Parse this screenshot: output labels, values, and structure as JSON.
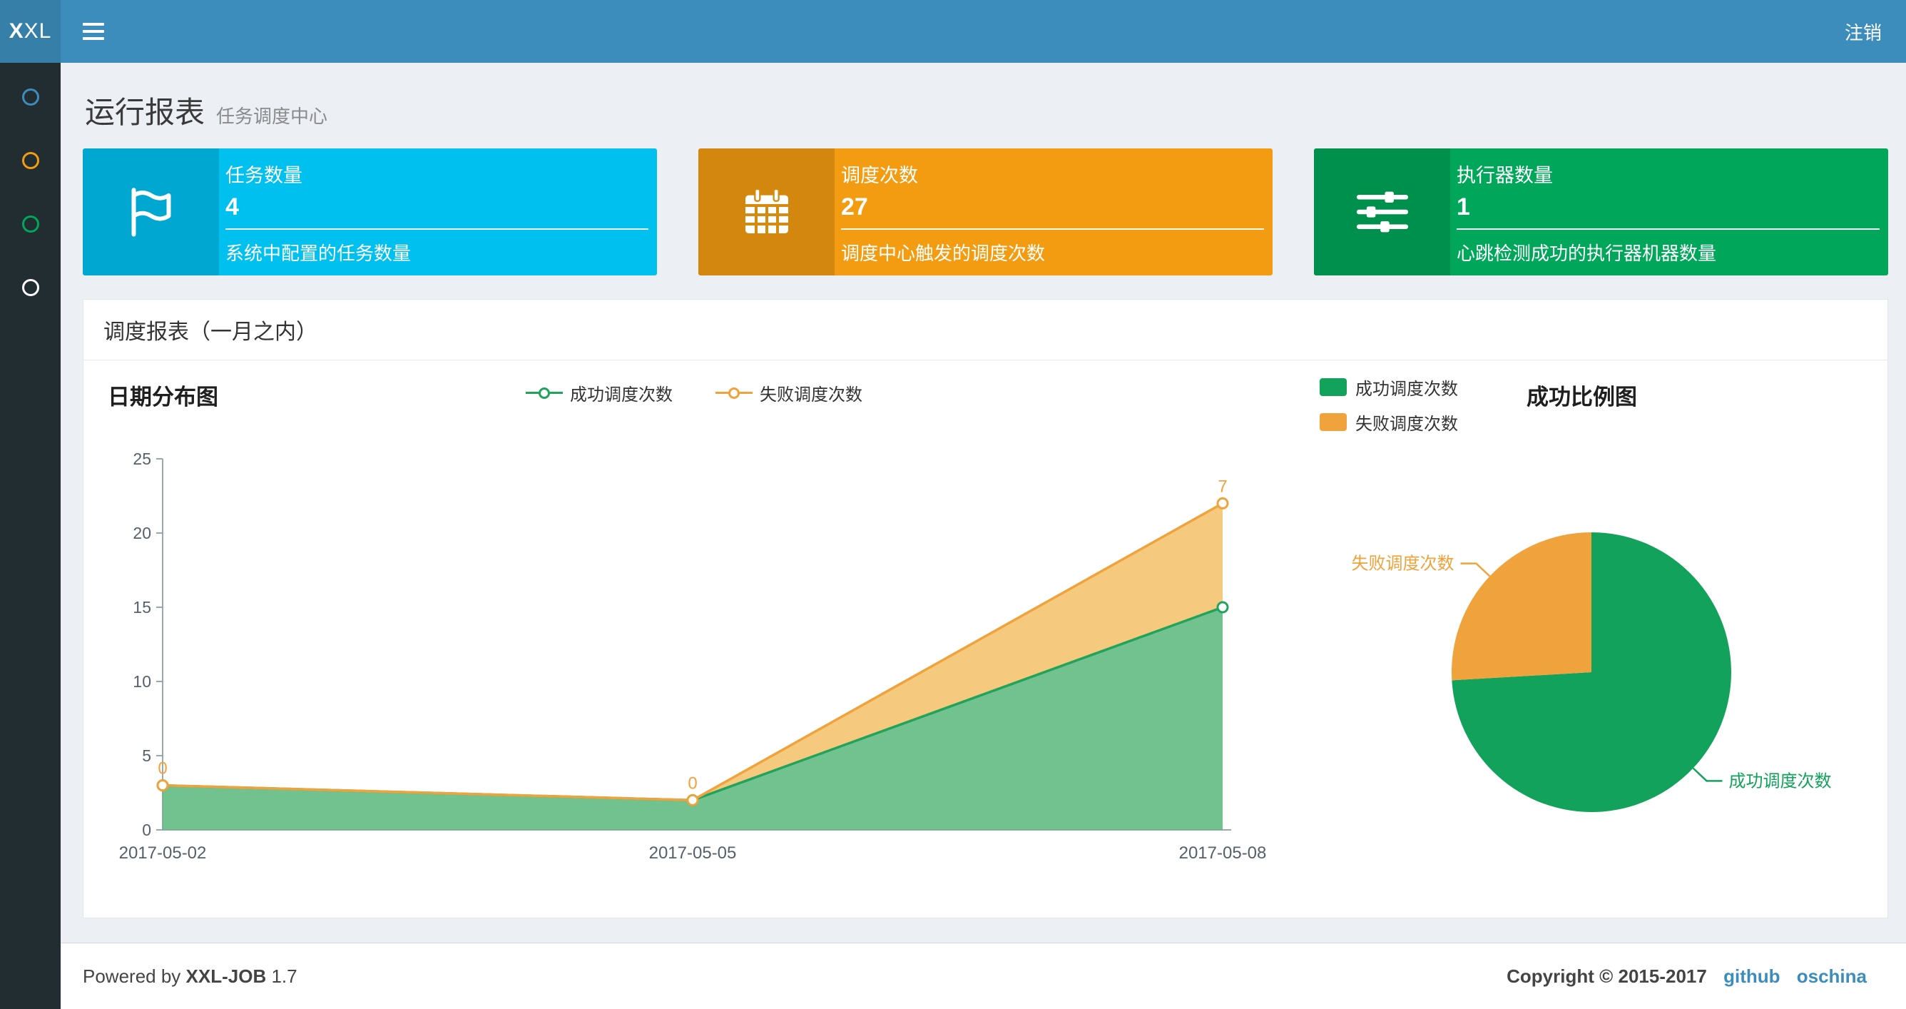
{
  "colors": {
    "navbar": "#3c8dbc",
    "logo_bg": "#367fa9",
    "sidebar_bg": "#222d32",
    "content_bg": "#ecf0f5",
    "link": "#3c8dbc"
  },
  "navbar": {
    "logo_bold": "X",
    "logo_rest": "XL",
    "logout": "注销"
  },
  "sidebar": {
    "items": [
      {
        "name": "menu-item-1",
        "color": "#3c8dbc"
      },
      {
        "name": "menu-item-2",
        "color": "#f39c12"
      },
      {
        "name": "menu-item-3",
        "color": "#00a65a"
      },
      {
        "name": "menu-item-4",
        "color": "#ffffff"
      }
    ]
  },
  "page_header": {
    "title": "运行报表",
    "subtitle": "任务调度中心"
  },
  "info_boxes": [
    {
      "label": "任务数量",
      "value": "4",
      "caption": "系统中配置的任务数量",
      "bg": "#00c0ef",
      "icon": "flag-icon"
    },
    {
      "label": "调度次数",
      "value": "27",
      "caption": "调度中心触发的调度次数",
      "bg": "#f39c12",
      "icon": "calendar-icon"
    },
    {
      "label": "执行器数量",
      "value": "1",
      "caption": "心跳检测成功的执行器机器数量",
      "bg": "#00a65a",
      "icon": "sliders-icon"
    }
  ],
  "panel": {
    "title": "调度报表（一月之内）"
  },
  "chart_data": [
    {
      "type": "area",
      "title": "日期分布图",
      "x": [
        "2017-05-02",
        "2017-05-05",
        "2017-05-08"
      ],
      "ylim": [
        0,
        25
      ],
      "yticks": [
        0,
        5,
        10,
        15,
        20,
        25
      ],
      "grid": false,
      "legend_position": "top-center",
      "series": [
        {
          "name": "成功调度次数",
          "values": [
            3,
            2,
            15
          ],
          "color": "#21a35c",
          "fill": "#5fba80"
        },
        {
          "name": "失败调度次数",
          "values": [
            0,
            0,
            7
          ],
          "stacked": true,
          "stacked_values": [
            3,
            2,
            22
          ],
          "color": "#f0a33c",
          "fill": "#f5c470",
          "point_labels": [
            "0",
            "0",
            "7"
          ]
        }
      ]
    },
    {
      "type": "pie",
      "title": "成功比例图",
      "legend_position": "top-left",
      "slices": [
        {
          "name": "成功调度次数",
          "value": 20,
          "color": "#12a25b"
        },
        {
          "name": "失败调度次数",
          "value": 7,
          "color": "#f0a33c"
        }
      ]
    }
  ],
  "footer": {
    "powered_prefix": "Powered by",
    "product": "XXL-JOB",
    "version": "1.7",
    "copyright": "Copyright © 2015-2017",
    "links": [
      "github",
      "oschina"
    ]
  }
}
